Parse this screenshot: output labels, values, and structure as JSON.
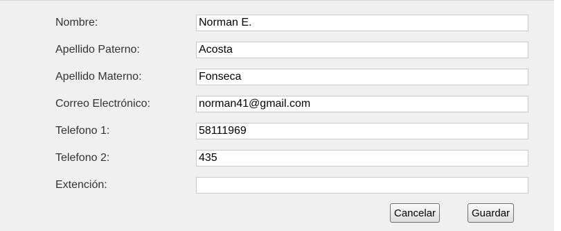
{
  "form": {
    "fields": [
      {
        "label": "Nombre:",
        "value": "Norman E.",
        "placeholder": ""
      },
      {
        "label": "Apellido Paterno:",
        "value": "Acosta",
        "placeholder": ""
      },
      {
        "label": "Apellido Materno:",
        "value": "Fonseca",
        "placeholder": ""
      },
      {
        "label": "Correo Electrónico:",
        "value": "norman41@gmail.com",
        "placeholder": ""
      },
      {
        "label": "Telefono 1:",
        "value": "58111969",
        "placeholder": ""
      },
      {
        "label": "Telefono 2:",
        "value": "435",
        "placeholder": ""
      },
      {
        "label": "Extención:",
        "value": "",
        "placeholder": ""
      }
    ],
    "buttons": {
      "cancel_label": "Cancelar",
      "save_label": "Guardar"
    }
  }
}
